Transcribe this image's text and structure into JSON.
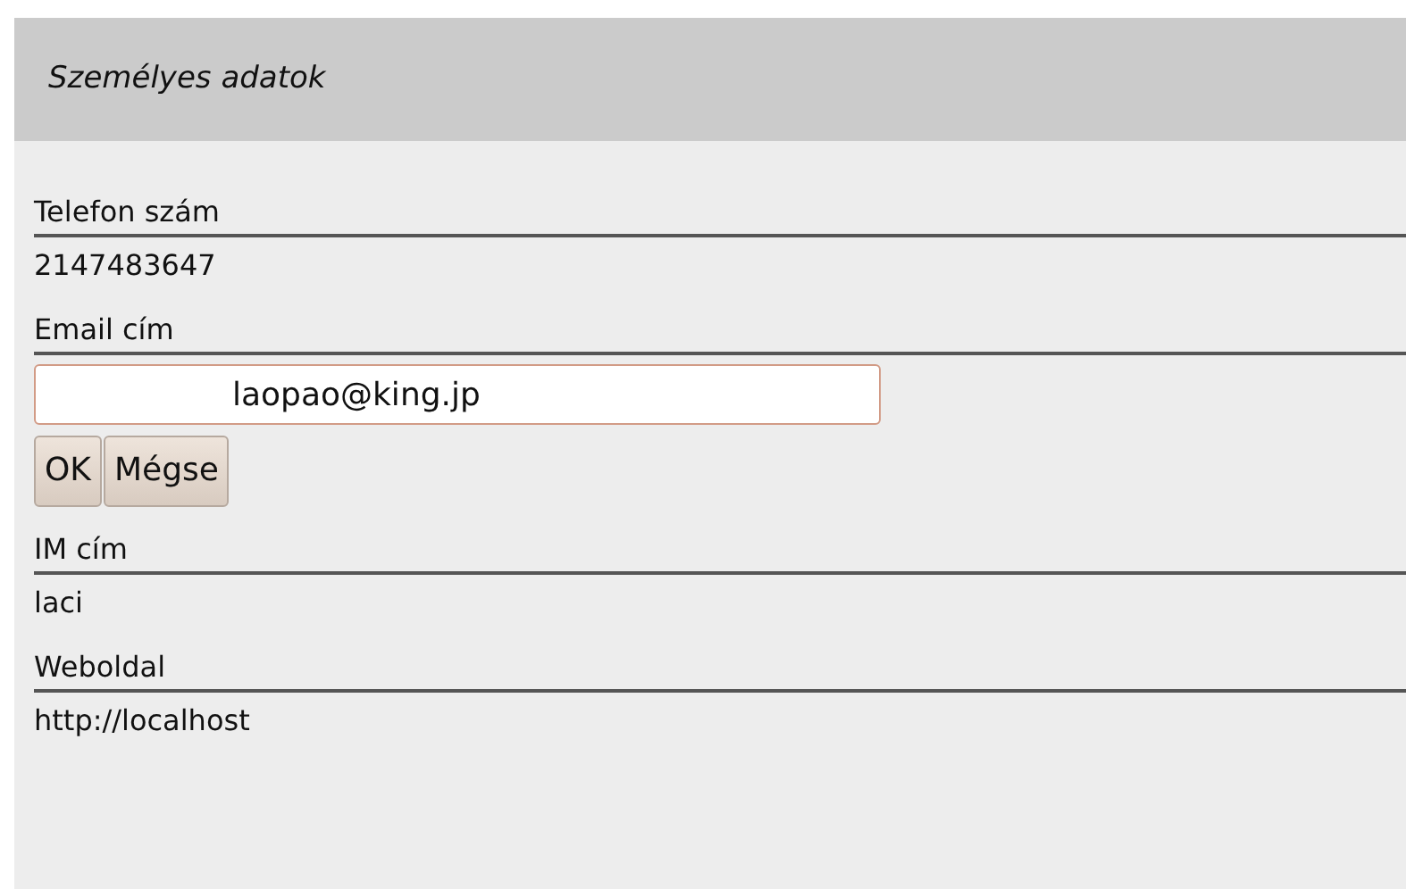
{
  "panel": {
    "title": "Személyes adatok"
  },
  "fields": [
    {
      "kind": "text",
      "label": "Telefon szám",
      "value": "2147483647"
    },
    {
      "kind": "edit",
      "label": "Email cím",
      "value": "laopao@king.jp",
      "buttons": [
        "OK",
        "Mégse"
      ]
    },
    {
      "kind": "text",
      "label": "IM cím",
      "value": "laci"
    },
    {
      "kind": "text",
      "label": "Weboldal",
      "value": "http://localhost"
    }
  ]
}
